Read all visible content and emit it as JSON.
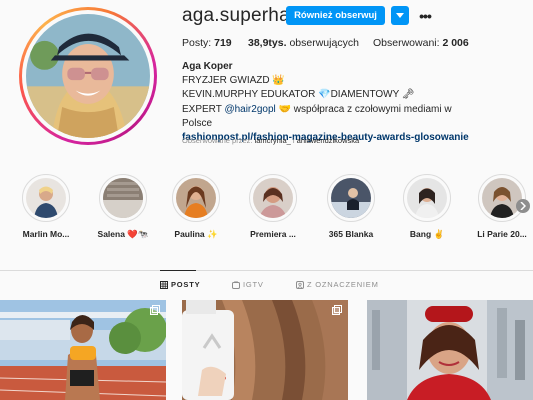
{
  "profile": {
    "username": "aga.superhair",
    "follow_label": "Również obserwuj",
    "more_label": "•••",
    "stats": {
      "posts_label": "Posty:",
      "posts_value": "719",
      "followers_value": "38,9tys.",
      "followers_label": "obserwujących",
      "following_label": "Obserwowani:",
      "following_value": "2 006"
    },
    "bio": {
      "name": "Aga Koper",
      "line1": "FRYZJER GWIAZD 👑",
      "line2": "KEVIN.MURPHY EDUKATOR 💎DIAMENTOWY 🗝",
      "line3_prefix": "EXPERT ",
      "line3_mention": "@hair2gopl",
      "line3_suffix": " 🤝 współpraca z czołowymi mediami w Polsce",
      "link": "fashionpost.pl/fashion-magazine-beauty-awards-glosowanie"
    },
    "followed_by": {
      "prefix": "Obserwowane przez: ",
      "user1": "iamcrynia_",
      "separator": " i ",
      "user2": "aniawendzikowska"
    }
  },
  "highlights": [
    {
      "label": "Marlin Mo..."
    },
    {
      "label": "Salena ❤️🐄"
    },
    {
      "label": "Paulina ✨"
    },
    {
      "label": "Premiera ..."
    },
    {
      "label": "365 Blanka"
    },
    {
      "label": "Bang ✌"
    },
    {
      "label": "Li Parie 20..."
    }
  ],
  "tabs": [
    {
      "label": "POSTY",
      "icon": "grid-icon"
    },
    {
      "label": "IGTV",
      "icon": "igtv-icon"
    },
    {
      "label": "Z OZNACZENIEM",
      "icon": "tagged-icon"
    }
  ],
  "colors": {
    "accent": "#0095f6",
    "link": "#00376b",
    "muted": "#8e8e8e"
  }
}
